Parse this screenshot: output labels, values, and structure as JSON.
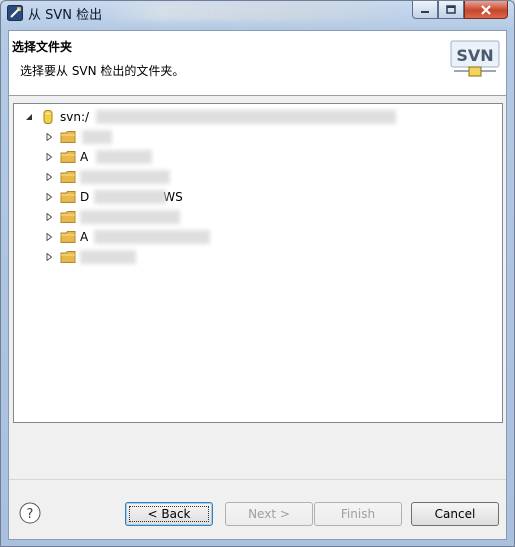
{
  "window": {
    "title": "从 SVN 检出"
  },
  "header": {
    "title": "选择文件夹",
    "description": "选择要从 SVN 检出的文件夹。",
    "logo_text": "SVN"
  },
  "tree": {
    "root_label": "svn:/",
    "items": [
      {
        "label": ""
      },
      {
        "label": "A"
      },
      {
        "label": ""
      },
      {
        "label": "D",
        "suffix": "WS"
      },
      {
        "label": ""
      },
      {
        "label": "A"
      },
      {
        "label": ""
      }
    ]
  },
  "buttons": {
    "back": "< Back",
    "next": "Next >",
    "finish": "Finish",
    "cancel": "Cancel"
  },
  "colors": {
    "folder": "#e8b94a",
    "focus_border": "#3c7fb1",
    "disabled_text": "#a0a0a0"
  }
}
